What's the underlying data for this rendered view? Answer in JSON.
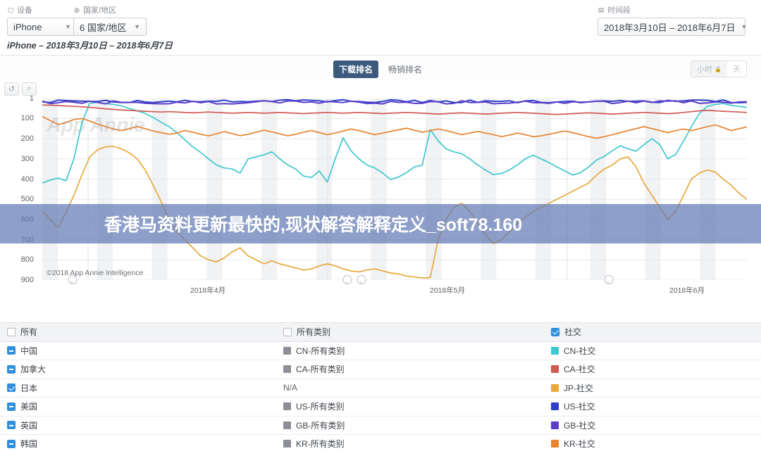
{
  "filters": {
    "device": {
      "label": "设备",
      "icon": "device-icon",
      "value": "iPhone"
    },
    "country": {
      "label": "国家/地区",
      "icon": "globe-icon",
      "value": "6 国家/地区"
    },
    "period": {
      "label": "时间段",
      "icon": "calendar-icon",
      "value": "2018年3月10日 – 2018年6月7日"
    },
    "subtitle": "iPhone – 2018年3月10日 – 2018年6月7日"
  },
  "toolbar": {
    "tabs": [
      {
        "label": "下载排名",
        "active": true
      },
      {
        "label": "畅销排名",
        "active": false
      }
    ],
    "unit_toggle": {
      "hour_label": "小时",
      "lock_glyph": "🔒",
      "day_label": "天"
    },
    "reset_glyph": "↺",
    "zoom_glyph": "⌕"
  },
  "overlay": {
    "text": "香港马资料更新最快的,现状解答解释定义_soft78.160",
    "color": "#627ab4"
  },
  "chart_data": {
    "type": "line",
    "title": "",
    "xlabel": "",
    "ylabel": "",
    "credit": "©2018 App Annie Intelligence",
    "watermark": "App Annie",
    "grid": true,
    "legend_position": "bottom-table",
    "y_inverted": true,
    "ylim": [
      1,
      900
    ],
    "yticks": [
      1,
      100,
      200,
      300,
      400,
      500,
      600,
      700,
      800,
      900
    ],
    "xticks": [
      {
        "label": "2018年4月",
        "pos": 0.235
      },
      {
        "label": "2018年5月",
        "pos": 0.575
      },
      {
        "label": "2018年6月",
        "pos": 0.915
      }
    ],
    "event_markers": [
      0.042,
      0.432,
      0.452,
      0.803
    ],
    "x_count": 90,
    "series": [
      {
        "name": "CN-社交",
        "color": "#3ec6cf",
        "values": [
          420,
          405,
          395,
          408,
          300,
          120,
          25,
          20,
          26,
          30,
          38,
          50,
          62,
          75,
          95,
          118,
          140,
          170,
          205,
          240,
          268,
          300,
          330,
          345,
          350,
          370,
          300,
          290,
          280,
          265,
          300,
          330,
          350,
          385,
          392,
          360,
          415,
          300,
          195,
          260,
          300,
          330,
          345,
          370,
          402,
          390,
          368,
          340,
          330,
          155,
          210,
          250,
          265,
          275,
          300,
          330,
          356,
          378,
          372,
          355,
          330,
          300,
          282,
          300,
          318,
          340,
          360,
          380,
          368,
          340,
          306,
          287,
          260,
          235,
          250,
          262,
          230,
          200,
          230,
          300,
          278,
          212,
          140,
          75,
          40,
          30,
          26,
          35,
          40,
          45
        ]
      },
      {
        "name": "CA-社交",
        "color": "#cf5a52",
        "values": [
          33,
          34,
          36,
          38,
          40,
          42,
          45,
          48,
          52,
          55,
          58,
          60,
          62,
          64,
          66,
          68,
          66,
          68,
          70,
          72,
          70,
          68,
          70,
          72,
          74,
          72,
          70,
          72,
          74,
          72,
          70,
          72,
          74,
          76,
          74,
          72,
          70,
          72,
          74,
          72,
          70,
          72,
          74,
          76,
          74,
          72,
          70,
          72,
          74,
          76,
          78,
          76,
          74,
          72,
          74,
          76,
          78,
          76,
          74,
          72,
          70,
          72,
          74,
          76,
          78,
          80,
          78,
          76,
          74,
          72,
          74,
          76,
          78,
          76,
          74,
          72,
          70,
          72,
          74,
          76,
          74,
          70,
          66,
          62,
          60,
          62,
          64,
          66,
          68,
          70
        ]
      },
      {
        "name": "JP-社交",
        "color": "#e8a83c",
        "values": [
          560,
          600,
          640,
          565,
          480,
          380,
          290,
          255,
          240,
          238,
          250,
          270,
          300,
          355,
          430,
          510,
          600,
          660,
          700,
          740,
          780,
          800,
          810,
          790,
          760,
          740,
          780,
          800,
          820,
          805,
          820,
          830,
          840,
          850,
          845,
          830,
          820,
          830,
          845,
          855,
          860,
          850,
          845,
          855,
          865,
          870,
          880,
          885,
          890,
          888,
          700,
          600,
          540,
          520,
          560,
          620,
          680,
          720,
          700,
          660,
          620,
          590,
          560,
          540,
          520,
          500,
          480,
          460,
          440,
          420,
          380,
          350,
          330,
          300,
          290,
          340,
          420,
          480,
          540,
          600,
          560,
          480,
          400,
          370,
          355,
          365,
          400,
          430,
          470,
          500
        ]
      },
      {
        "name": "US-社交",
        "color": "#2f3fc8"
      },
      {
        "name": "GB-社交",
        "color": "#5b3fc8"
      },
      {
        "name": "KR-社交",
        "color": "#e8822c",
        "values": [
          90,
          110,
          130,
          120,
          105,
          100,
          112,
          128,
          140,
          152,
          160,
          150,
          140,
          150,
          162,
          170,
          178,
          172,
          160,
          168,
          178,
          186,
          176,
          165,
          175,
          185,
          178,
          168,
          158,
          166,
          176,
          186,
          178,
          168,
          160,
          170,
          180,
          172,
          162,
          152,
          160,
          170,
          180,
          172,
          164,
          156,
          148,
          158,
          168,
          160,
          152,
          160,
          170,
          180,
          172,
          164,
          172,
          180,
          190,
          182,
          172,
          180,
          190,
          186,
          178,
          170,
          162,
          170,
          180,
          190,
          198,
          190,
          180,
          170,
          160,
          150,
          140,
          150,
          160,
          170,
          160,
          152,
          160,
          150,
          140,
          132,
          145,
          160,
          150,
          142
        ]
      }
    ],
    "top_band_series": [
      {
        "name": "US-社交",
        "color": "#2f3fc8"
      },
      {
        "name": "GB-社交",
        "color": "#5b3fc8"
      }
    ]
  },
  "legend": {
    "header": {
      "all_label": "所有",
      "all_categories_label": "所有类别",
      "social_label": "社交",
      "all_checked": false,
      "all_categories_checked": false,
      "social_checked": true
    },
    "rows": [
      {
        "country": "中国",
        "country_state": "indet",
        "category": "CN-所有类别",
        "category_color": "#8c9096",
        "social": "CN-社交",
        "social_color": "#3ec6cf"
      },
      {
        "country": "加拿大",
        "country_state": "indet",
        "category": "CA-所有类别",
        "category_color": "#8c9096",
        "social": "CA-社交",
        "social_color": "#cf5a52"
      },
      {
        "country": "日本",
        "country_state": "checked",
        "category": "N/A",
        "category_color": "none",
        "social": "JP-社交",
        "social_color": "#e8a83c"
      },
      {
        "country": "美国",
        "country_state": "indet",
        "category": "US-所有类别",
        "category_color": "#8c9096",
        "social": "US-社交",
        "social_color": "#2f3fc8"
      },
      {
        "country": "英国",
        "country_state": "indet",
        "category": "GB-所有类别",
        "category_color": "#8c9096",
        "social": "GB-社交",
        "social_color": "#5b3fc8"
      },
      {
        "country": "韩国",
        "country_state": "indet",
        "category": "KR-所有类别",
        "category_color": "#8c9096",
        "social": "KR-社交",
        "social_color": "#e8822c"
      }
    ]
  }
}
